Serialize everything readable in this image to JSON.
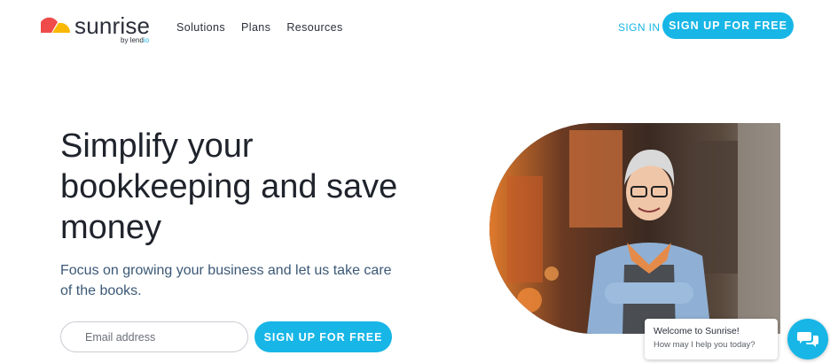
{
  "brand": {
    "name": "sunrise",
    "by_prefix": "by lend",
    "by_accent": "io",
    "colors": {
      "accent": "#17b6e6",
      "logo_red": "#ef4b4b",
      "logo_yellow": "#f9b800",
      "text_dark": "#1f232b",
      "subtext": "#3b5876"
    }
  },
  "nav": {
    "items": [
      "Solutions",
      "Plans",
      "Resources"
    ],
    "sign_in": "SIGN IN",
    "cta": "SIGN UP FOR FREE"
  },
  "hero": {
    "title": "Simplify your bookkeeping and save money",
    "subtitle": "Focus on growing your business and let us take care of the books.",
    "email_placeholder": "Email address",
    "cta": "SIGN UP FOR FREE",
    "image_alt": "Smiling woman in apron with arms crossed in a shop"
  },
  "chat": {
    "title": "Welcome to Sunrise!",
    "message": "How may I help you today?",
    "launcher_icon": "chat-icon"
  }
}
